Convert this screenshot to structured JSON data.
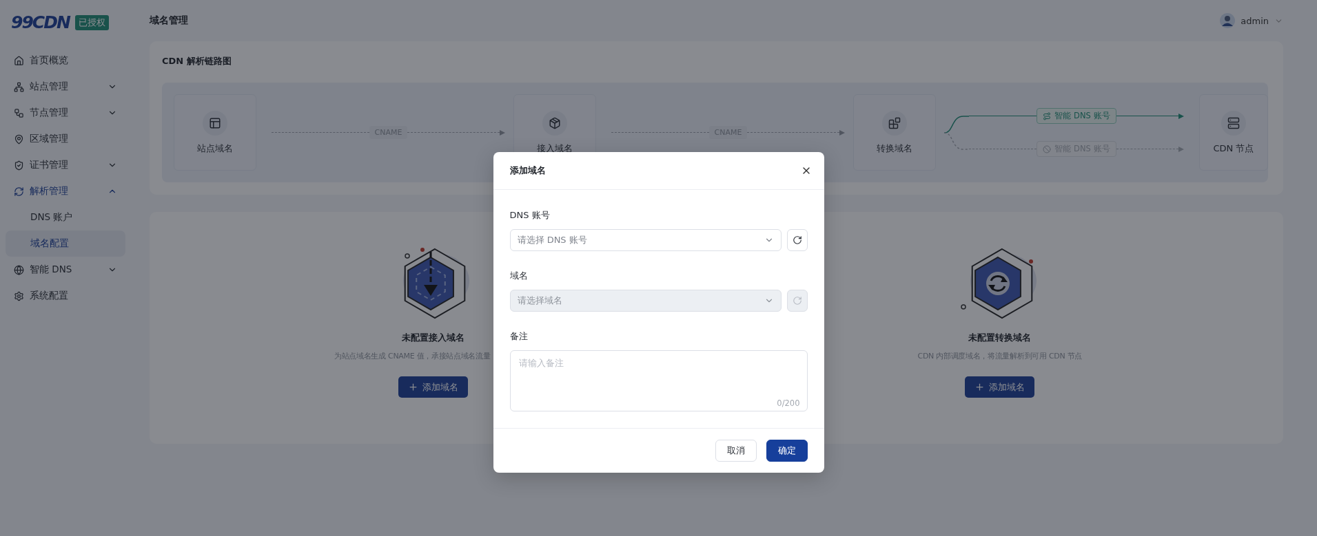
{
  "logo": {
    "text": "99CDN",
    "badge": "已授权"
  },
  "sidebar": {
    "items": [
      {
        "label": "首页概览"
      },
      {
        "label": "站点管理",
        "expanded": false
      },
      {
        "label": "节点管理",
        "expanded": false
      },
      {
        "label": "区域管理"
      },
      {
        "label": "证书管理",
        "expanded": false
      },
      {
        "label": "解析管理",
        "expanded": true,
        "children": [
          {
            "label": "DNS 账户",
            "selected": false
          },
          {
            "label": "域名配置",
            "selected": true
          }
        ]
      },
      {
        "label": "智能 DNS",
        "expanded": false
      },
      {
        "label": "系统配置"
      }
    ]
  },
  "header": {
    "title": "域名管理",
    "user": "admin"
  },
  "diagram": {
    "title": "CDN 解析链路图",
    "nodes": [
      {
        "label": "站点域名"
      },
      {
        "label": "接入域名"
      },
      {
        "label": "转换域名"
      },
      {
        "label": "CDN 节点"
      }
    ],
    "links": [
      "CNAME",
      "CNAME"
    ],
    "routes": [
      {
        "label": "智能 DNS 账号",
        "active": true
      },
      {
        "label": "智能 DNS 账号",
        "active": false
      }
    ]
  },
  "empty_cards": [
    {
      "title": "未配置接入域名",
      "description": "为站点域名生成 CNAME 值，承接站点域名流量",
      "button": "添加域名"
    },
    {
      "title": "未配置转换域名",
      "description": "CDN 内部调度域名，将流量解析到可用 CDN 节点",
      "button": "添加域名"
    }
  ],
  "dialog": {
    "title": "添加域名",
    "fields": [
      {
        "kind": "select",
        "label": "DNS 账号",
        "placeholder": "请选择 DNS 账号",
        "disabled": false
      },
      {
        "kind": "select",
        "label": "域名",
        "placeholder": "请选择域名",
        "disabled": true
      },
      {
        "kind": "textarea",
        "label": "备注",
        "placeholder": "请输入备注",
        "counter": "0/200"
      }
    ],
    "buttons": [
      {
        "label": "取消",
        "primary": false
      },
      {
        "label": "确定",
        "primary": true
      }
    ]
  }
}
